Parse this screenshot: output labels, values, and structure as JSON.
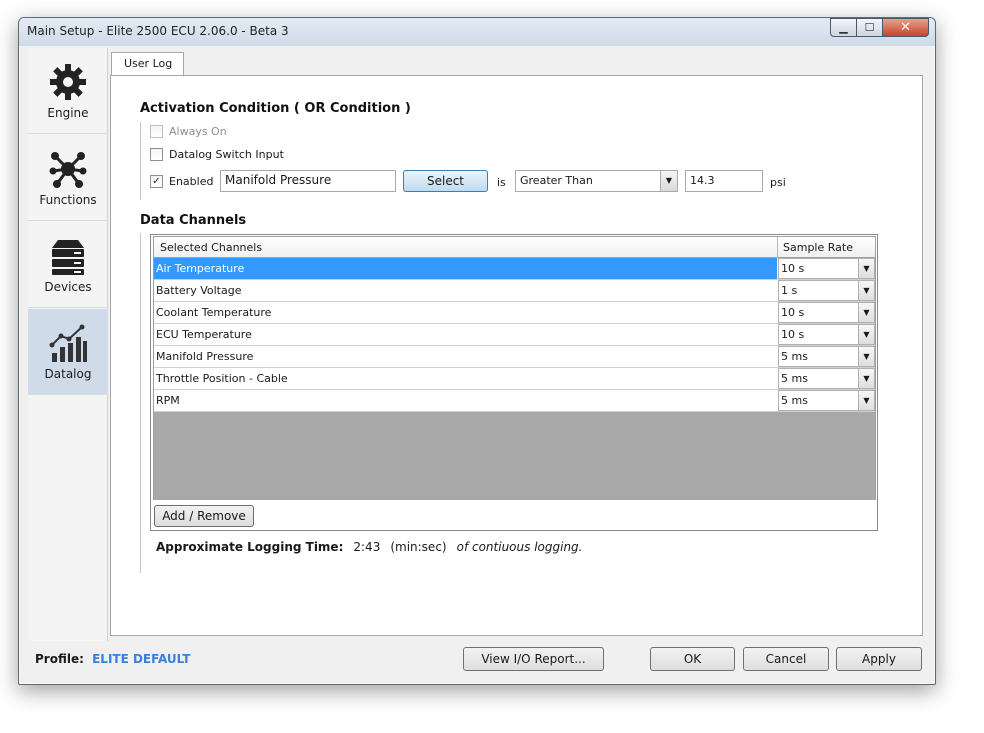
{
  "window": {
    "title": "Main Setup - Elite 2500 ECU 2.06.0 - Beta 3"
  },
  "sidebar": {
    "items": [
      {
        "label": "Engine",
        "icon": "gear-icon",
        "active": false
      },
      {
        "label": "Functions",
        "icon": "network-icon",
        "active": false
      },
      {
        "label": "Devices",
        "icon": "server-stack-icon",
        "active": false
      },
      {
        "label": "Datalog",
        "icon": "chart-icon",
        "active": true
      }
    ]
  },
  "tabs": [
    {
      "label": "User Log"
    }
  ],
  "activation": {
    "title": "Activation Condition ( OR Condition )",
    "always_on": {
      "label": "Always On",
      "checked": false,
      "disabled": true
    },
    "switch_input": {
      "label": "Datalog Switch Input",
      "checked": false
    },
    "enabled": {
      "label": "Enabled",
      "checked": true,
      "channel_value": "Manifold Pressure",
      "select_label": "Select",
      "is_label": "is",
      "operator": "Greater Than",
      "threshold": "14.3",
      "unit": "psi"
    }
  },
  "data_channels": {
    "title": "Data Channels",
    "columns": [
      "Selected Channels",
      "Sample Rate"
    ],
    "rows": [
      {
        "name": "Air Temperature",
        "rate": "10 s"
      },
      {
        "name": "Battery Voltage",
        "rate": "1 s"
      },
      {
        "name": "Coolant Temperature",
        "rate": "10 s"
      },
      {
        "name": "ECU Temperature",
        "rate": "10 s"
      },
      {
        "name": "Manifold Pressure",
        "rate": "5 ms"
      },
      {
        "name": "Throttle Position - Cable",
        "rate": "5 ms"
      },
      {
        "name": "RPM",
        "rate": "5 ms"
      }
    ],
    "add_remove_label": "Add / Remove"
  },
  "logging": {
    "label": "Approximate Logging Time:",
    "time": "2:43",
    "unit": "(min:sec)",
    "note": "of contiuous logging."
  },
  "footer": {
    "profile_label": "Profile:",
    "profile_value": "ELITE DEFAULT",
    "report_label": "View I/O Report...",
    "ok_label": "OK",
    "cancel_label": "Cancel",
    "apply_label": "Apply"
  },
  "colors": {
    "accent": "#3399ff",
    "profile": "#3a7fd8",
    "selected_nav": "#cfdbe9"
  }
}
